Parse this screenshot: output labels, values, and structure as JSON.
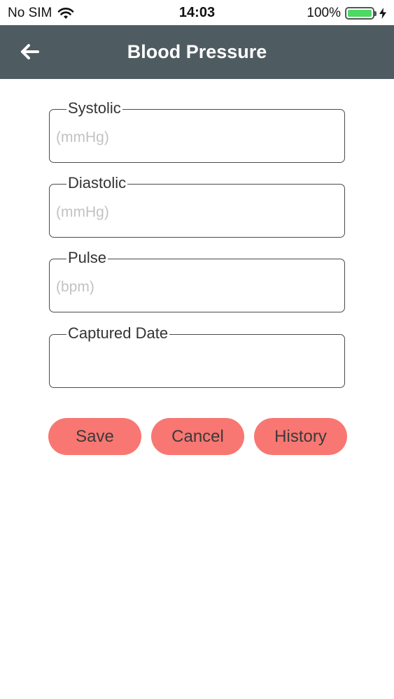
{
  "status_bar": {
    "carrier": "No SIM",
    "time": "14:03",
    "battery": "100%",
    "battery_level": 1.0,
    "wifi_icon": "wifi-icon",
    "charging_icon": "bolt-icon"
  },
  "nav": {
    "title": "Blood Pressure",
    "back_icon": "arrow-left-icon"
  },
  "form": {
    "systolic": {
      "label": "Systolic",
      "placeholder": "(mmHg)",
      "value": ""
    },
    "diastolic": {
      "label": "Diastolic",
      "placeholder": "(mmHg)",
      "value": ""
    },
    "pulse": {
      "label": "Pulse",
      "placeholder": "(bpm)",
      "value": ""
    },
    "captured_date": {
      "label": "Captured Date",
      "placeholder": "",
      "value": ""
    }
  },
  "actions": {
    "save": "Save",
    "cancel": "Cancel",
    "history": "History"
  },
  "colors": {
    "nav_bg": "#4e5b61",
    "button_bg": "#f87772",
    "battery_green": "#4cd964"
  }
}
